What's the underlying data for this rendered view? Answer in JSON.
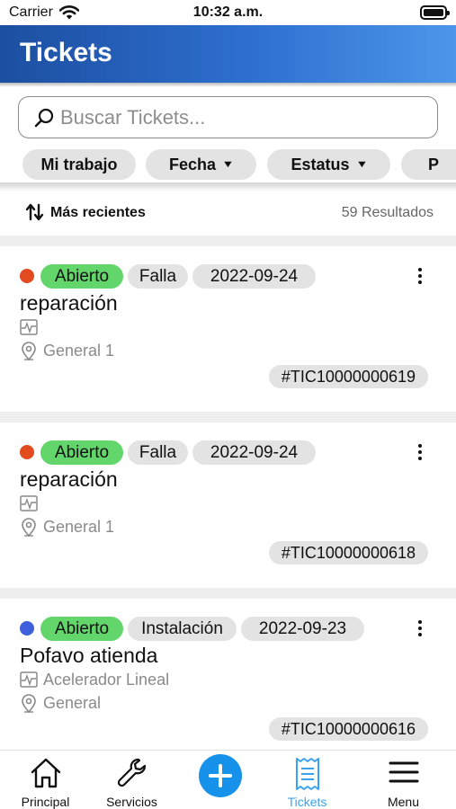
{
  "status_bar": {
    "carrier": "Carrier",
    "time": "10:32 a.m."
  },
  "header": {
    "title": "Tickets"
  },
  "search": {
    "placeholder": "Buscar Tickets..."
  },
  "filters": [
    {
      "label": "Mi trabajo"
    },
    {
      "label": "Fecha"
    },
    {
      "label": "Estatus"
    },
    {
      "label": "P"
    }
  ],
  "sort": {
    "label": "Más recientes",
    "results": "59 Resultados"
  },
  "tickets": [
    {
      "status": "Abierto",
      "status_dot_color": "#e24a1f",
      "type": "Falla",
      "date": "2022-09-24",
      "title": "reparación",
      "equipment": "",
      "location": "General 1",
      "id": "#TIC10000000619"
    },
    {
      "status": "Abierto",
      "status_dot_color": "#e24a1f",
      "type": "Falla",
      "date": "2022-09-24",
      "title": "reparación",
      "equipment": "",
      "location": "General 1",
      "id": "#TIC10000000618"
    },
    {
      "status": "Abierto",
      "status_dot_color": "#3f5fdc",
      "type": "Instalación",
      "date": "2022-09-23",
      "title": "Pofavo atienda",
      "equipment": "Acelerador Lineal",
      "location": "General",
      "id": "#TIC10000000616"
    }
  ],
  "tabbar": {
    "items": [
      {
        "label": "Principal",
        "icon": "home-icon"
      },
      {
        "label": "Servicios",
        "icon": "wrench-icon"
      },
      {
        "label": "",
        "icon": "add-icon"
      },
      {
        "label": "Tickets",
        "icon": "receipt-icon",
        "active": true
      },
      {
        "label": "Menu",
        "icon": "hamburger-icon"
      }
    ],
    "active_color": "#39a3f0"
  },
  "colors": {
    "header_start": "#1c4fa0",
    "header_end": "#4d95ea",
    "status_badge": "#62d56b",
    "add_button": "#1692ea"
  }
}
